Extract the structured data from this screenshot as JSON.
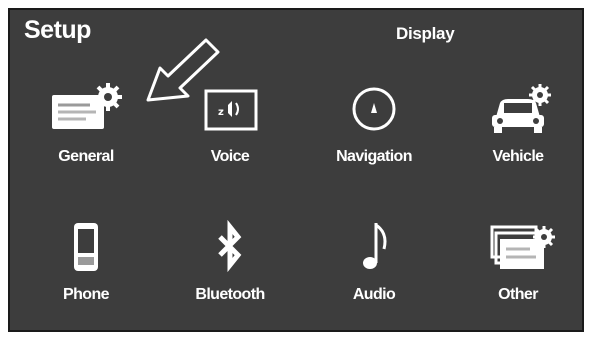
{
  "header": {
    "title": "Setup",
    "display_button": "Display"
  },
  "menu": {
    "items": [
      {
        "label": "General",
        "icon": "general-settings-icon"
      },
      {
        "label": "Voice",
        "icon": "voice-icon"
      },
      {
        "label": "Navigation",
        "icon": "navigation-compass-icon"
      },
      {
        "label": "Vehicle",
        "icon": "vehicle-settings-icon"
      },
      {
        "label": "Phone",
        "icon": "phone-icon"
      },
      {
        "label": "Bluetooth",
        "icon": "bluetooth-icon"
      },
      {
        "label": "Audio",
        "icon": "audio-note-icon"
      },
      {
        "label": "Other",
        "icon": "other-settings-icon"
      }
    ]
  },
  "colors": {
    "background": "#3d3d3d",
    "foreground": "#ffffff",
    "border": "#1a1a1a"
  }
}
